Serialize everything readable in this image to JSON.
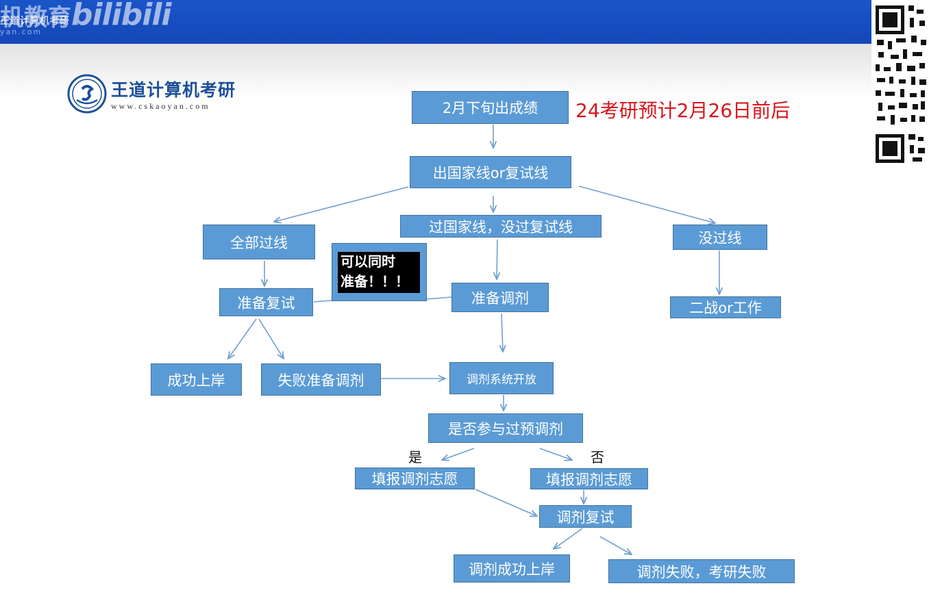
{
  "watermark": {
    "channel_name": "机教育",
    "channel_sub": "王道计算机考研",
    "channel_url": "yan.com",
    "platform_logo": "bilibili"
  },
  "logo": {
    "title": "王道计算机考研",
    "url": "www.cskaoyan.com",
    "icon": "wangdao-seal-icon"
  },
  "note": "24考研预计2月26日前后",
  "side_note": "可以同时\n准备！！！",
  "nodes": {
    "results": "2月下旬出成绩",
    "line_check": "出国家线or复试线",
    "all_pass": "全部过线",
    "national_only": "过国家线，没过复试线",
    "no_pass": "没过线",
    "prep_retest": "准备复试",
    "prep_adjust": "准备调剂",
    "retry_or_work": "二战or工作",
    "success": "成功上岸",
    "fail_adjust": "失败准备调剂",
    "system_open": "调剂系统开放",
    "pre_adjust_q": "是否参与过预调剂",
    "fill_yes": "填报调剂志愿",
    "fill_no": "填报调剂志愿",
    "adjust_retest": "调剂复试",
    "adjust_success": "调剂成功上岸",
    "adjust_fail": "调剂失败，考研失败"
  },
  "edge_labels": {
    "yes": "是",
    "no": "否"
  },
  "colors": {
    "node_fill": "#5b9bd5",
    "node_border": "#41719c",
    "arrow": "#6f9fd0",
    "note_red": "#d9141b",
    "banner": "#1a55c8"
  }
}
